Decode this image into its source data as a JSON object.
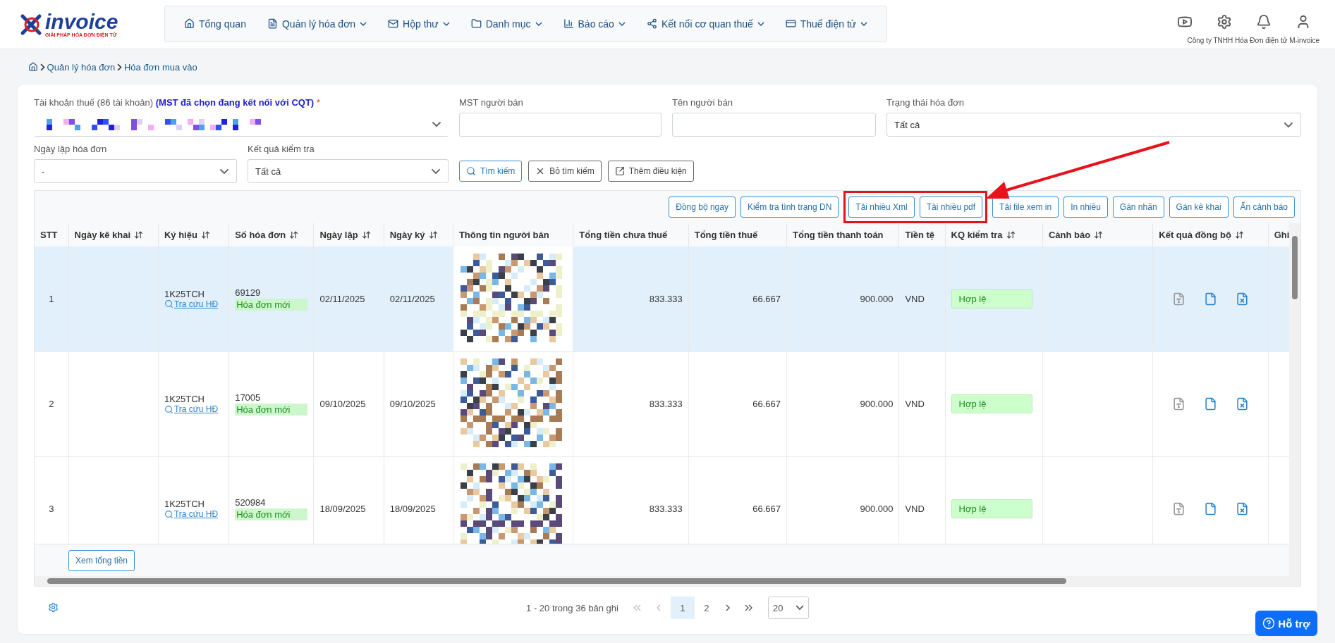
{
  "logo": {
    "name": "invoice",
    "tagline": "GIẢI PHÁP HÓA ĐƠN ĐIỆN TỬ"
  },
  "nav": [
    {
      "label": "Tổng quan",
      "dropdown": false
    },
    {
      "label": "Quản lý hóa đơn",
      "dropdown": true
    },
    {
      "label": "Hộp thư",
      "dropdown": true
    },
    {
      "label": "Danh mục",
      "dropdown": true
    },
    {
      "label": "Báo cáo",
      "dropdown": true
    },
    {
      "label": "Kết nối cơ quan thuế",
      "dropdown": true
    },
    {
      "label": "Thuế điện tử",
      "dropdown": true
    }
  ],
  "company": "Công ty TNHH Hóa Đơn điện tử M-invoice",
  "breadcrumb": [
    "Quản lý hóa đơn",
    "Hóa đơn mua vào"
  ],
  "filters": {
    "account": {
      "label": "Tài khoản thuế (86 tài khoản)",
      "note": "(MST đã chọn đang kết nối với CQT)",
      "required_mark": "*"
    },
    "seller_tax_code": {
      "label": "MST người bán"
    },
    "seller_name": {
      "label": "Tên người bán"
    },
    "invoice_status": {
      "label": "Trạng thái hóa đơn",
      "value": "Tất cả"
    },
    "invoice_date": {
      "label": "Ngày lập hóa đơn",
      "value": "-"
    },
    "check_result": {
      "label": "Kết quả kiểm tra",
      "value": "Tất cả"
    },
    "buttons": [
      {
        "label": "Tìm kiếm",
        "primary": true
      },
      {
        "label": "Bỏ tìm kiếm",
        "primary": false
      },
      {
        "label": "Thêm điều kiện",
        "primary": false
      }
    ]
  },
  "toolbar": {
    "before": [
      "Đồng bộ ngay",
      "Kiểm tra tình trạng DN"
    ],
    "highlighted": [
      "Tải nhiều Xml",
      "Tải nhiều pdf"
    ],
    "after": [
      "Tải file xem in",
      "In nhiều",
      "Gán nhãn",
      "Gán kê khai",
      "Ẩn cảnh báo"
    ]
  },
  "table": {
    "columns": [
      {
        "label": "STT",
        "sortable": false
      },
      {
        "label": "Ngày kê khai",
        "sortable": true
      },
      {
        "label": "Ký hiệu",
        "sortable": true
      },
      {
        "label": "Số hóa đơn",
        "sortable": true
      },
      {
        "label": "Ngày lập",
        "sortable": true
      },
      {
        "label": "Ngày ký",
        "sortable": true
      },
      {
        "label": "Thông tin người bán",
        "sortable": false
      },
      {
        "label": "Tổng tiền chưa thuế",
        "sortable": false
      },
      {
        "label": "Tổng tiền thuế",
        "sortable": false
      },
      {
        "label": "Tổng tiền thanh toán",
        "sortable": false
      },
      {
        "label": "Tiền tệ",
        "sortable": false
      },
      {
        "label": "KQ kiểm tra",
        "sortable": true
      },
      {
        "label": "Cảnh báo",
        "sortable": true
      },
      {
        "label": "Kết quả đồng bộ",
        "sortable": true
      },
      {
        "label": "Ghi"
      }
    ],
    "rows": [
      {
        "stt": "1",
        "symbol": "1K25TCH",
        "lookup": "Tra cứu HĐ",
        "number": "69129",
        "status": "Hóa đơn mới",
        "date": "02/11/2025",
        "signed": "02/11/2025",
        "pre_tax": "833.333",
        "tax": "66.667",
        "total": "900.000",
        "currency": "VND",
        "check": "Hợp lệ",
        "selected": true
      },
      {
        "stt": "2",
        "symbol": "1K25TCH",
        "lookup": "Tra cứu HĐ",
        "number": "17005",
        "status": "Hóa đơn mới",
        "date": "09/10/2025",
        "signed": "09/10/2025",
        "pre_tax": "833.333",
        "tax": "66.667",
        "total": "900.000",
        "currency": "VND",
        "check": "Hợp lệ",
        "selected": false
      },
      {
        "stt": "3",
        "symbol": "1K25TCH",
        "lookup": "Tra cứu HĐ",
        "number": "520984",
        "status": "Hóa đơn mới",
        "date": "18/09/2025",
        "signed": "18/09/2025",
        "pre_tax": "833.333",
        "tax": "66.667",
        "total": "900.000",
        "currency": "VND",
        "check": "Hợp lệ",
        "selected": false
      }
    ],
    "footer_button": "Xem tổng tiền"
  },
  "pagination": {
    "summary": "1 - 20 trong 36 bản ghi",
    "pages": [
      {
        "label": "1",
        "selected": true
      },
      {
        "label": "2",
        "selected": false
      }
    ],
    "first_disabled": true,
    "prev_disabled": true,
    "page_size": "20"
  },
  "help_button": "Hỗ trợ"
}
